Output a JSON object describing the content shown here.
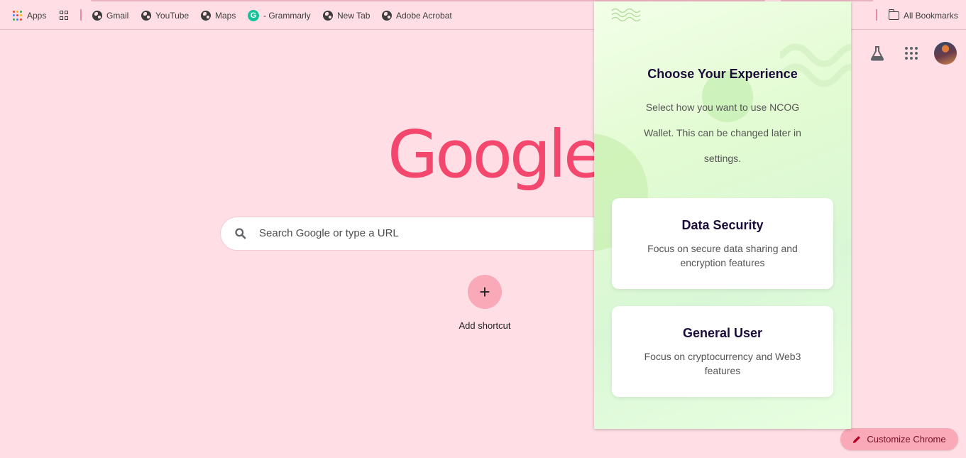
{
  "bookmarks": {
    "apps_label": "Apps",
    "items": [
      "Gmail",
      "YouTube",
      "Maps",
      "- Grammarly",
      "New Tab",
      "Adobe Acrobat"
    ],
    "all_bookmarks": "All Bookmarks"
  },
  "google": {
    "logo": "Google",
    "search_placeholder": "Search Google or type a URL",
    "add_shortcut": "Add shortcut",
    "customize": "Customize Chrome"
  },
  "popup": {
    "title": "Choose Your Experience",
    "description": "Select how you want to use NCOG Wallet. This can be changed later in settings.",
    "options": [
      {
        "title": "Data Security",
        "description": "Focus on secure data sharing and encryption features"
      },
      {
        "title": "General User",
        "description": "Focus on cryptocurrency and Web3 features"
      }
    ]
  },
  "colors": {
    "page_bg": "#ffdfe5",
    "logo": "#f4476e",
    "accent": "#f9a9b8",
    "popup_heading": "#1b0b3a"
  }
}
